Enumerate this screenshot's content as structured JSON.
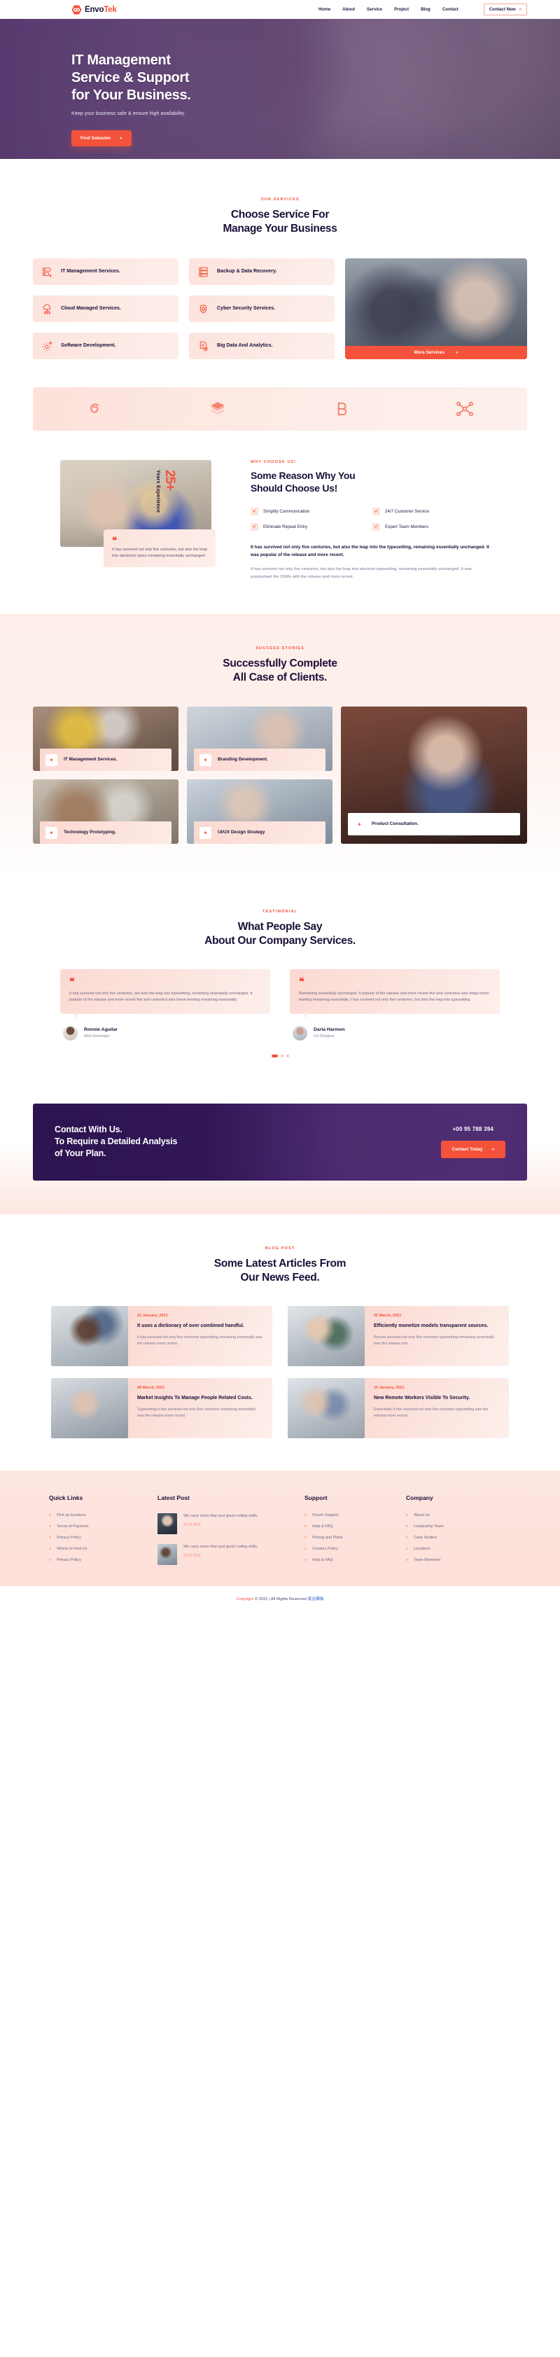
{
  "brand": {
    "name_dark": "Envo",
    "name_accent": "Tek",
    "logo_icon": "hexagon-logo-icon"
  },
  "nav": {
    "items": [
      {
        "label": "Home"
      },
      {
        "label": "About"
      },
      {
        "label": "Service"
      },
      {
        "label": "Project"
      },
      {
        "label": "Blog"
      },
      {
        "label": "Contact"
      }
    ],
    "cta": {
      "label": "Contact Now",
      "arrow": "»"
    }
  },
  "hero": {
    "title_line1": "IT Management",
    "title_line2": "Service & Support",
    "title_line3": "for Your Business.",
    "subtitle": "Keep your business safe & ensure high availability.",
    "button": {
      "label": "Find Solusion",
      "arrow": "»"
    }
  },
  "services": {
    "eyebrow": "OUR SERVICES",
    "title_line1": "Choose Service For",
    "title_line2": "Manage Your Business",
    "cards": [
      {
        "label": "IT Management Services.",
        "icon": "server-click-icon"
      },
      {
        "label": "Backup & Data Recovery.",
        "icon": "server-rack-icon"
      },
      {
        "label": "Cloud Managed Services.",
        "icon": "cloud-network-icon"
      },
      {
        "label": "Cyber Security Services.",
        "icon": "shield-cog-icon"
      },
      {
        "label": "Software Development.",
        "icon": "gear-code-icon"
      },
      {
        "label": "Big Data And Analytics.",
        "icon": "document-check-icon"
      }
    ],
    "more_button": {
      "label": "More Services",
      "arrow": "»"
    }
  },
  "partners": {
    "logos": [
      {
        "name": "spiral-partner-logo"
      },
      {
        "name": "layers-partner-logo"
      },
      {
        "name": "bee-partner-logo"
      },
      {
        "name": "molecule-partner-logo"
      }
    ]
  },
  "choose": {
    "eyebrow": "WHY CHOOSE US!",
    "title_line1": "Some Reason Why You",
    "title_line2": "Should Choose Us!",
    "years_number": "25+",
    "years_label": "Years Experience",
    "quote": "It has survived not only five centuries, but also the leap into electronic types remaining essentially unchanged.",
    "features": [
      "Simplify Communication",
      "24/7 Customer Service",
      "Eliminate Repeat Entry",
      "Expert Team Members"
    ],
    "lead": "It has survived not only five centuries, but also the leap into the typesetting, remaining essentially unchanged. It was popular of the release and more recent.",
    "body": "It has survived not only five centuries, but also the leap into electroni typesetting, remaining essentially unchanged. It was popularised the 1960s with the release and more recent."
  },
  "cases": {
    "eyebrow": "SUCCESS STORIES",
    "title_line1": "Successfully Complete",
    "title_line2": "All Case of Clients.",
    "items": [
      {
        "label": "IT Management Services.",
        "icon": "sparkle-icon"
      },
      {
        "label": "Branding Development.",
        "icon": "sparkle-icon"
      },
      {
        "label": "Technology Prototyping.",
        "icon": "sparkle-icon"
      },
      {
        "label": "UI/UX Design Strategy",
        "icon": "sparkle-icon"
      },
      {
        "label": "Product Consultation.",
        "icon": "sparkle-icon"
      }
    ]
  },
  "testimonials": {
    "eyebrow": "TESTIMONIAL",
    "title_line1": "What People Say",
    "title_line2": "About Our Company Services.",
    "items": [
      {
        "quote_mark": "❝",
        "text": "It has survived not only five centuries, but also the leap into typesetting, remaining essentially unchanged. It popular of the release and more recent five and centurbut also these tesetng remaining essentially.",
        "name": "Ronnie Aguilar",
        "role": "Web Developer"
      },
      {
        "quote_mark": "❝",
        "text": "Remaining essentially unchanged. It popular of the release and more recent five and centurbut also today these tesetng remaining essentially, t has survived not only five centuries, but also the leap into typesetting.",
        "name": "Darla Harmon",
        "role": "UX Designer"
      }
    ]
  },
  "cta": {
    "title_line1": "Contact With Us.",
    "title_line2": "To Require a Detailed Analysis",
    "title_line3": "of Your Plan.",
    "phone": "+00 95 788 394",
    "button": {
      "label": "Contact Today",
      "arrow": "»"
    }
  },
  "blog": {
    "eyebrow": "BLOG POST",
    "title_line1": "Some Latest Articles From",
    "title_line2": "Our News Feed.",
    "posts": [
      {
        "date": "22 January, 2021",
        "title": "It uses a dictionary of over combined handful.",
        "desc": "It has survived not only five centuries typesetting remaining essentially was the release more recent."
      },
      {
        "date": "02 March, 2021",
        "title": "Efficiently monetize models transparent sources.",
        "desc": "Recent survived not only five centuries typesetting remaining essentially was the release mor."
      },
      {
        "date": "08 March, 2021",
        "title": "Market Insights To Manage People Related Costs.",
        "desc": "Typesetting It has survived not only five centuries remaining essentially was the release more recent."
      },
      {
        "date": "15 January, 2021",
        "title": "New Remote Workers Visible To Security.",
        "desc": "Essentially It has survived not only five centuries typesetting was the release more recent."
      }
    ]
  },
  "footer": {
    "columns": [
      {
        "heading": "Quick Links",
        "links": [
          "Pick up locations",
          "Terms of Payment",
          "Privacy Policy",
          "Where to Find Us",
          "Privacy Policy"
        ]
      },
      {
        "heading": "Latest Post",
        "posts": [
          {
            "text": "We carry more than just good coding skills.",
            "date": "22.01.2021"
          },
          {
            "text": "We carry more than just good coding skills.",
            "date": "22.01.2021"
          }
        ]
      },
      {
        "heading": "Support",
        "links": [
          "Forum Support",
          "Help & FAQ",
          "Pricing and Plans",
          "Cookies Policy",
          "Help & FAQ"
        ]
      },
      {
        "heading": "Company",
        "links": [
          "About Us",
          "Leadership Team",
          "Case Studies",
          "Locations",
          "Team Members"
        ]
      }
    ],
    "bullet": "»",
    "copyright_prefix": "Copyright",
    "copyright_mid": "© 2021 | All Rights Reserved",
    "copyright_link": "莫治模板"
  },
  "colors": {
    "accent": "#f4523b",
    "dark": "#1b0f38",
    "hero_purple": "#553670",
    "soft_pink": "#fde3dc"
  }
}
